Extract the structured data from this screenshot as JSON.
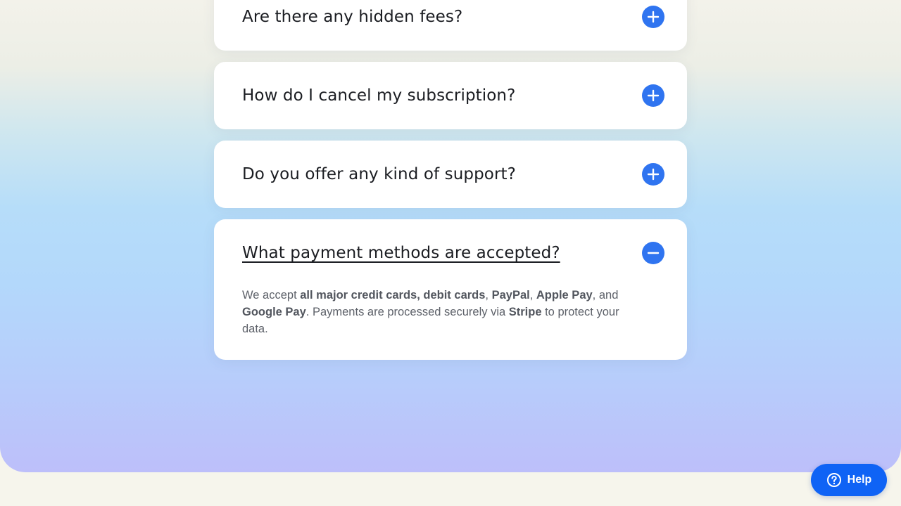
{
  "faq": {
    "items": [
      {
        "question": "Are there any hidden fees?",
        "expanded": false,
        "toggle_icon": "plus-icon"
      },
      {
        "question": "How do I cancel my subscription?",
        "expanded": false,
        "toggle_icon": "plus-icon"
      },
      {
        "question": "Do you offer any kind of support?",
        "expanded": false,
        "toggle_icon": "plus-icon"
      },
      {
        "question": "What payment methods are accepted?",
        "expanded": true,
        "toggle_icon": "minus-icon",
        "answer": {
          "t1": "We accept ",
          "b1": "all major credit cards, debit cards",
          "t2": ", ",
          "b2": "PayPal",
          "t3": ", ",
          "b3": "Apple Pay",
          "t4": ", and ",
          "b4": "Google Pay",
          "t5": ". Payments are processed securely via ",
          "b5": "Stripe",
          "t6": " to protect your data."
        }
      }
    ]
  },
  "help": {
    "label": "Help",
    "icon": "question-circle-icon"
  },
  "colors": {
    "accent": "#2f74f0",
    "help_button": "#0f63f5",
    "question_text": "#1b1d22",
    "answer_text": "#5d6169"
  }
}
